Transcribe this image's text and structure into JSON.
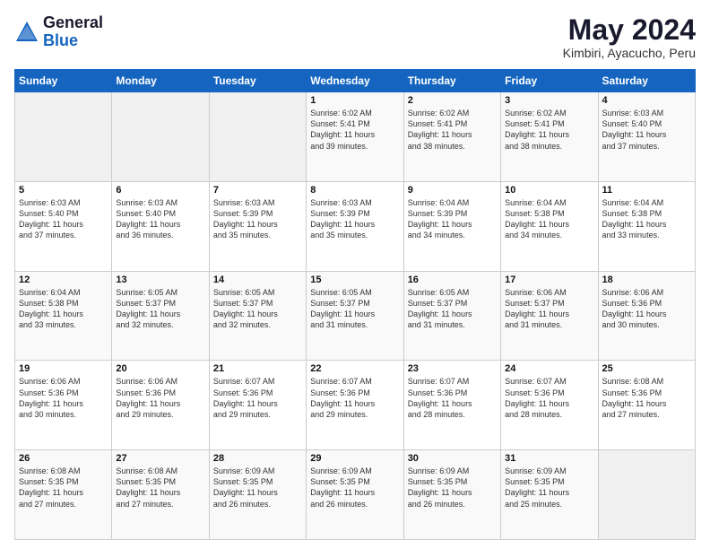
{
  "header": {
    "logo_general": "General",
    "logo_blue": "Blue",
    "month_title": "May 2024",
    "location": "Kimbiri, Ayacucho, Peru"
  },
  "weekdays": [
    "Sunday",
    "Monday",
    "Tuesday",
    "Wednesday",
    "Thursday",
    "Friday",
    "Saturday"
  ],
  "weeks": [
    [
      {
        "day": "",
        "info": ""
      },
      {
        "day": "",
        "info": ""
      },
      {
        "day": "",
        "info": ""
      },
      {
        "day": "1",
        "info": "Sunrise: 6:02 AM\nSunset: 5:41 PM\nDaylight: 11 hours\nand 39 minutes."
      },
      {
        "day": "2",
        "info": "Sunrise: 6:02 AM\nSunset: 5:41 PM\nDaylight: 11 hours\nand 38 minutes."
      },
      {
        "day": "3",
        "info": "Sunrise: 6:02 AM\nSunset: 5:41 PM\nDaylight: 11 hours\nand 38 minutes."
      },
      {
        "day": "4",
        "info": "Sunrise: 6:03 AM\nSunset: 5:40 PM\nDaylight: 11 hours\nand 37 minutes."
      }
    ],
    [
      {
        "day": "5",
        "info": "Sunrise: 6:03 AM\nSunset: 5:40 PM\nDaylight: 11 hours\nand 37 minutes."
      },
      {
        "day": "6",
        "info": "Sunrise: 6:03 AM\nSunset: 5:40 PM\nDaylight: 11 hours\nand 36 minutes."
      },
      {
        "day": "7",
        "info": "Sunrise: 6:03 AM\nSunset: 5:39 PM\nDaylight: 11 hours\nand 35 minutes."
      },
      {
        "day": "8",
        "info": "Sunrise: 6:03 AM\nSunset: 5:39 PM\nDaylight: 11 hours\nand 35 minutes."
      },
      {
        "day": "9",
        "info": "Sunrise: 6:04 AM\nSunset: 5:39 PM\nDaylight: 11 hours\nand 34 minutes."
      },
      {
        "day": "10",
        "info": "Sunrise: 6:04 AM\nSunset: 5:38 PM\nDaylight: 11 hours\nand 34 minutes."
      },
      {
        "day": "11",
        "info": "Sunrise: 6:04 AM\nSunset: 5:38 PM\nDaylight: 11 hours\nand 33 minutes."
      }
    ],
    [
      {
        "day": "12",
        "info": "Sunrise: 6:04 AM\nSunset: 5:38 PM\nDaylight: 11 hours\nand 33 minutes."
      },
      {
        "day": "13",
        "info": "Sunrise: 6:05 AM\nSunset: 5:37 PM\nDaylight: 11 hours\nand 32 minutes."
      },
      {
        "day": "14",
        "info": "Sunrise: 6:05 AM\nSunset: 5:37 PM\nDaylight: 11 hours\nand 32 minutes."
      },
      {
        "day": "15",
        "info": "Sunrise: 6:05 AM\nSunset: 5:37 PM\nDaylight: 11 hours\nand 31 minutes."
      },
      {
        "day": "16",
        "info": "Sunrise: 6:05 AM\nSunset: 5:37 PM\nDaylight: 11 hours\nand 31 minutes."
      },
      {
        "day": "17",
        "info": "Sunrise: 6:06 AM\nSunset: 5:37 PM\nDaylight: 11 hours\nand 31 minutes."
      },
      {
        "day": "18",
        "info": "Sunrise: 6:06 AM\nSunset: 5:36 PM\nDaylight: 11 hours\nand 30 minutes."
      }
    ],
    [
      {
        "day": "19",
        "info": "Sunrise: 6:06 AM\nSunset: 5:36 PM\nDaylight: 11 hours\nand 30 minutes."
      },
      {
        "day": "20",
        "info": "Sunrise: 6:06 AM\nSunset: 5:36 PM\nDaylight: 11 hours\nand 29 minutes."
      },
      {
        "day": "21",
        "info": "Sunrise: 6:07 AM\nSunset: 5:36 PM\nDaylight: 11 hours\nand 29 minutes."
      },
      {
        "day": "22",
        "info": "Sunrise: 6:07 AM\nSunset: 5:36 PM\nDaylight: 11 hours\nand 29 minutes."
      },
      {
        "day": "23",
        "info": "Sunrise: 6:07 AM\nSunset: 5:36 PM\nDaylight: 11 hours\nand 28 minutes."
      },
      {
        "day": "24",
        "info": "Sunrise: 6:07 AM\nSunset: 5:36 PM\nDaylight: 11 hours\nand 28 minutes."
      },
      {
        "day": "25",
        "info": "Sunrise: 6:08 AM\nSunset: 5:36 PM\nDaylight: 11 hours\nand 27 minutes."
      }
    ],
    [
      {
        "day": "26",
        "info": "Sunrise: 6:08 AM\nSunset: 5:35 PM\nDaylight: 11 hours\nand 27 minutes."
      },
      {
        "day": "27",
        "info": "Sunrise: 6:08 AM\nSunset: 5:35 PM\nDaylight: 11 hours\nand 27 minutes."
      },
      {
        "day": "28",
        "info": "Sunrise: 6:09 AM\nSunset: 5:35 PM\nDaylight: 11 hours\nand 26 minutes."
      },
      {
        "day": "29",
        "info": "Sunrise: 6:09 AM\nSunset: 5:35 PM\nDaylight: 11 hours\nand 26 minutes."
      },
      {
        "day": "30",
        "info": "Sunrise: 6:09 AM\nSunset: 5:35 PM\nDaylight: 11 hours\nand 26 minutes."
      },
      {
        "day": "31",
        "info": "Sunrise: 6:09 AM\nSunset: 5:35 PM\nDaylight: 11 hours\nand 25 minutes."
      },
      {
        "day": "",
        "info": ""
      }
    ]
  ]
}
